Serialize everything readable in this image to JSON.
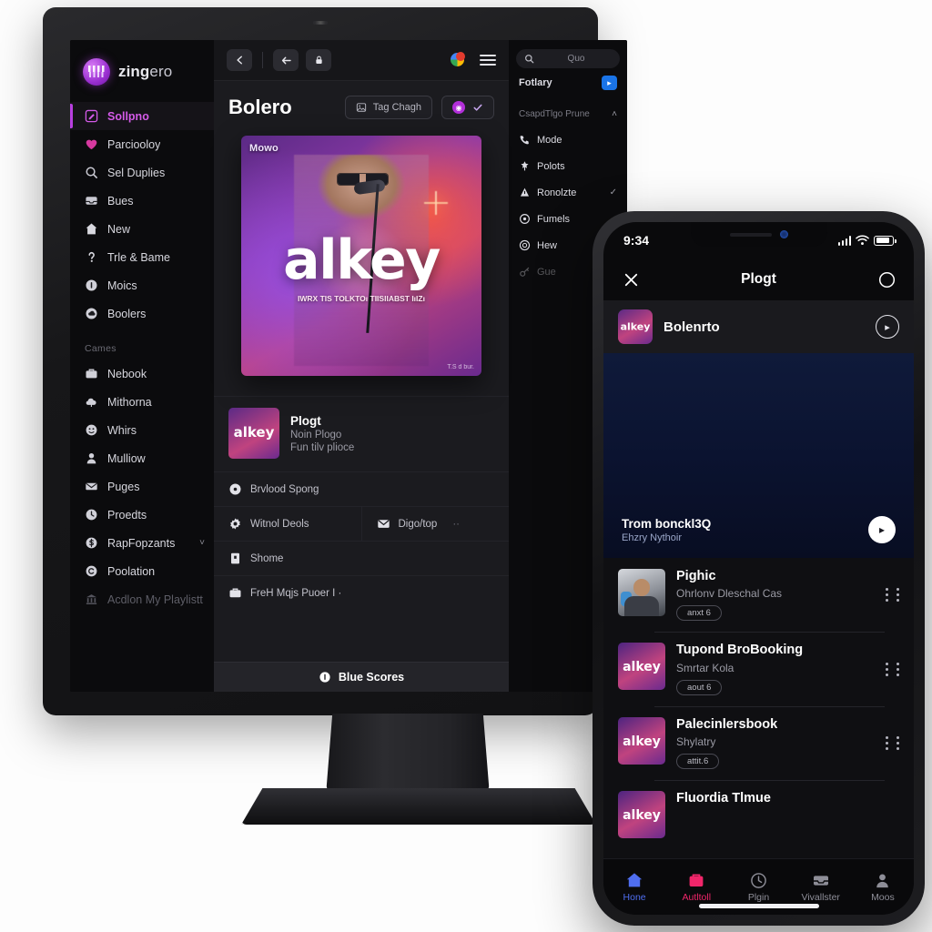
{
  "desktop": {
    "brand": {
      "name_bold": "zing",
      "name_rest": "ero"
    },
    "sidebar": {
      "items": [
        {
          "label": "Sollpno",
          "icon": "edit-square-icon",
          "active": true
        },
        {
          "label": "Parciooloy",
          "icon": "heart-icon"
        },
        {
          "label": "Sel Duplies",
          "icon": "search-icon"
        },
        {
          "label": "Bues",
          "icon": "inbox-icon"
        },
        {
          "label": "New",
          "icon": "home-icon"
        },
        {
          "label": "Trle & Bame",
          "icon": "help-icon"
        },
        {
          "label": "Moics",
          "icon": "info-icon"
        },
        {
          "label": "Boolers",
          "icon": "cloud-icon"
        }
      ],
      "section_label": "Cames",
      "section_items": [
        {
          "label": "Nebook",
          "icon": "briefcase-icon"
        },
        {
          "label": "Mithorna",
          "icon": "cloud-upload-icon"
        },
        {
          "label": "Whirs",
          "icon": "smiley-icon"
        },
        {
          "label": "Mulliow",
          "icon": "person-icon"
        },
        {
          "label": "Puges",
          "icon": "mail-icon"
        },
        {
          "label": "Proedts",
          "icon": "clock-icon"
        },
        {
          "label": "RapFopzants",
          "icon": "dollar-icon",
          "caret": "˅"
        },
        {
          "label": "Poolation",
          "icon": "circle-c-icon"
        },
        {
          "label": "Acdlon My Playlistt",
          "icon": "bank-icon",
          "muted": true
        }
      ]
    },
    "toolbar": {
      "back_icon": "chevron-left-icon",
      "forward_icon": "arrow-left-icon",
      "lock_icon": "lock-icon",
      "chrome_icon": "chrome-icon",
      "menu_icon": "hamburger-icon"
    },
    "page": {
      "title": "Bolero",
      "tag_button": "Tag Chagh",
      "tag_button_icon": "image-tag-icon",
      "pill_icon": "record-icon",
      "pill_check": "check-icon"
    },
    "cover": {
      "badge": "Mowo",
      "word": "alkey",
      "subtitle": "IWRX TIS TOLKTOı\nTIISIIABST IıIZı",
      "corner": "T.S d   bur."
    },
    "nowplaying": {
      "title": "Plogt",
      "line1": "Noin Plogo",
      "line2": "Fun tilv plioce",
      "art_word": "alkey"
    },
    "rows": [
      {
        "label": "Brvlood Spong",
        "icon": "disc-icon"
      }
    ],
    "split_rows": [
      {
        "label": "Witnol Deols",
        "icon": "gear-icon"
      },
      {
        "label": "Digo/top",
        "icon": "mail-icon",
        "trailing": "··"
      }
    ],
    "rows2": [
      {
        "label": "Shome",
        "icon": "book-icon"
      },
      {
        "label": "FreH Mqjs Puoer I ·",
        "icon": "briefcase-icon"
      }
    ],
    "status": {
      "label": "Blue Scores",
      "icon": "info-icon"
    },
    "right_panel": {
      "search_placeholder": "Quo",
      "search_icon": "search-icon",
      "first_row": {
        "label": "Fotlary",
        "badge": "▸"
      },
      "group_label": "CsapdTlgo Prune",
      "group_caret": "˄",
      "items": [
        {
          "label": "Mode",
          "icon": "phone-icon",
          "right": ""
        },
        {
          "label": "Polots",
          "icon": "pin-icon",
          "right": ""
        },
        {
          "label": "Ronolzte",
          "icon": "alert-icon",
          "right": "✓"
        },
        {
          "label": "Fumels",
          "icon": "target-icon",
          "right": ""
        },
        {
          "label": "Hew",
          "icon": "circle-dot-icon",
          "right": "⑂"
        },
        {
          "label": "Gue",
          "icon": "key-icon",
          "right": "",
          "fade": true
        }
      ]
    }
  },
  "phone": {
    "status": {
      "time": "9:34",
      "signal_icon": "cellular-icon",
      "wifi_icon": "wifi-icon",
      "battery_icon": "battery-icon"
    },
    "header": {
      "close_icon": "close-icon",
      "title": "Plogt",
      "circle_icon": "circle-icon"
    },
    "track_card": {
      "title": "Bolenrto",
      "art_word": "alkey",
      "action_icon": "play-chevron-icon"
    },
    "waveform": {
      "title": "Trom bonckl3Q",
      "subtitle": "Ehzry Nythoir",
      "play_icon": "play-icon",
      "left_color": "#ff4fd8",
      "right_color": "#4fc3ff"
    },
    "playlist": [
      {
        "title": "Pighic",
        "subtitle": "Ohrlonv Dleschal Cas",
        "chip": "anxt 6",
        "art": "person"
      },
      {
        "title": "Tupond BroBooking",
        "subtitle": "Smrtar Kola",
        "chip": "aout 6",
        "art": "alkey"
      },
      {
        "title": "Palecinlersbook",
        "subtitle": "Shylatry",
        "chip": "attit.6",
        "art": "alkey"
      },
      {
        "title": "Fluordia Tlmue",
        "subtitle": "",
        "chip": "",
        "art": "alkey"
      }
    ],
    "tabs": [
      {
        "label": "Hone",
        "icon": "home-icon",
        "color": "#4f6ef0",
        "active": true
      },
      {
        "label": "Autltoll",
        "icon": "bag-icon",
        "color": "#f0266a",
        "active": true
      },
      {
        "label": "Plgin",
        "icon": "clock-icon",
        "color": "#8e8e98"
      },
      {
        "label": "Vivallster",
        "icon": "inbox-icon",
        "color": "#8e8e98"
      },
      {
        "label": "Moos",
        "icon": "person-icon",
        "color": "#8e8e98"
      }
    ]
  }
}
